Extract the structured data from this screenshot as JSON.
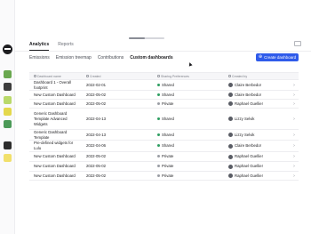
{
  "progress": 0.45,
  "nav": {
    "tabs": [
      {
        "label": "Analytics",
        "active": true
      },
      {
        "label": "Reports",
        "active": false
      }
    ],
    "subtabs": [
      {
        "label": "Emissions",
        "active": false
      },
      {
        "label": "Emission treemap",
        "active": false
      },
      {
        "label": "Contributions",
        "active": false
      },
      {
        "label": "Custom dashboards",
        "active": true
      }
    ]
  },
  "actions": {
    "create_label": "Create dashboard",
    "create_icon": "plus-circle-icon"
  },
  "table": {
    "columns": [
      "Dashboard name",
      "Created",
      "Sharing Preferences",
      "Created by"
    ],
    "rows": [
      {
        "name": "Dashboard 1 - Overall footprint",
        "created": "2022-02-01",
        "sharing": "Shared",
        "creator": "Claire Berbedor"
      },
      {
        "name": "New Custom Dashboard",
        "created": "2022-05-02",
        "sharing": "Shared",
        "creator": "Claire Berbedor"
      },
      {
        "name": "New Custom Dashboard",
        "created": "2022-05-02",
        "sharing": "Private",
        "creator": "Raphael Guellier"
      },
      {
        "name": "Generic Dashboard Template Advanced Widgets",
        "created": "2022-04-13",
        "sharing": "Shared",
        "creator": "Lizzy Selvik"
      },
      {
        "name": "Generic Dashboard Template",
        "created": "2022-04-13",
        "sharing": "Shared",
        "creator": "Lizzy Selvik"
      },
      {
        "name": "Pre-defined widgets for Lulu",
        "created": "2022-04-06",
        "sharing": "Shared",
        "creator": "Claire Berbedor"
      },
      {
        "name": "New Custom Dashboard",
        "created": "2022-05-02",
        "sharing": "Private",
        "creator": "Raphael Guellier"
      },
      {
        "name": "New Custom Dashboard",
        "created": "2022-05-02",
        "sharing": "Private",
        "creator": "Raphael Guellier"
      },
      {
        "name": "New Custom Dashboard",
        "created": "2022-05-02",
        "sharing": "Private",
        "creator": "Raphael Guellier"
      }
    ]
  },
  "colors": {
    "accent": "#2f5bea",
    "shared_dot": "#2e9e61",
    "private_dot": "#9a9da4"
  },
  "icons": {
    "sidebar": [
      "plant-icon",
      "eyes-icon",
      "lightbulb-icon",
      "leaf-icon",
      "tree-icon",
      "graduation-cap-icon",
      "light-bulb-icon"
    ]
  }
}
